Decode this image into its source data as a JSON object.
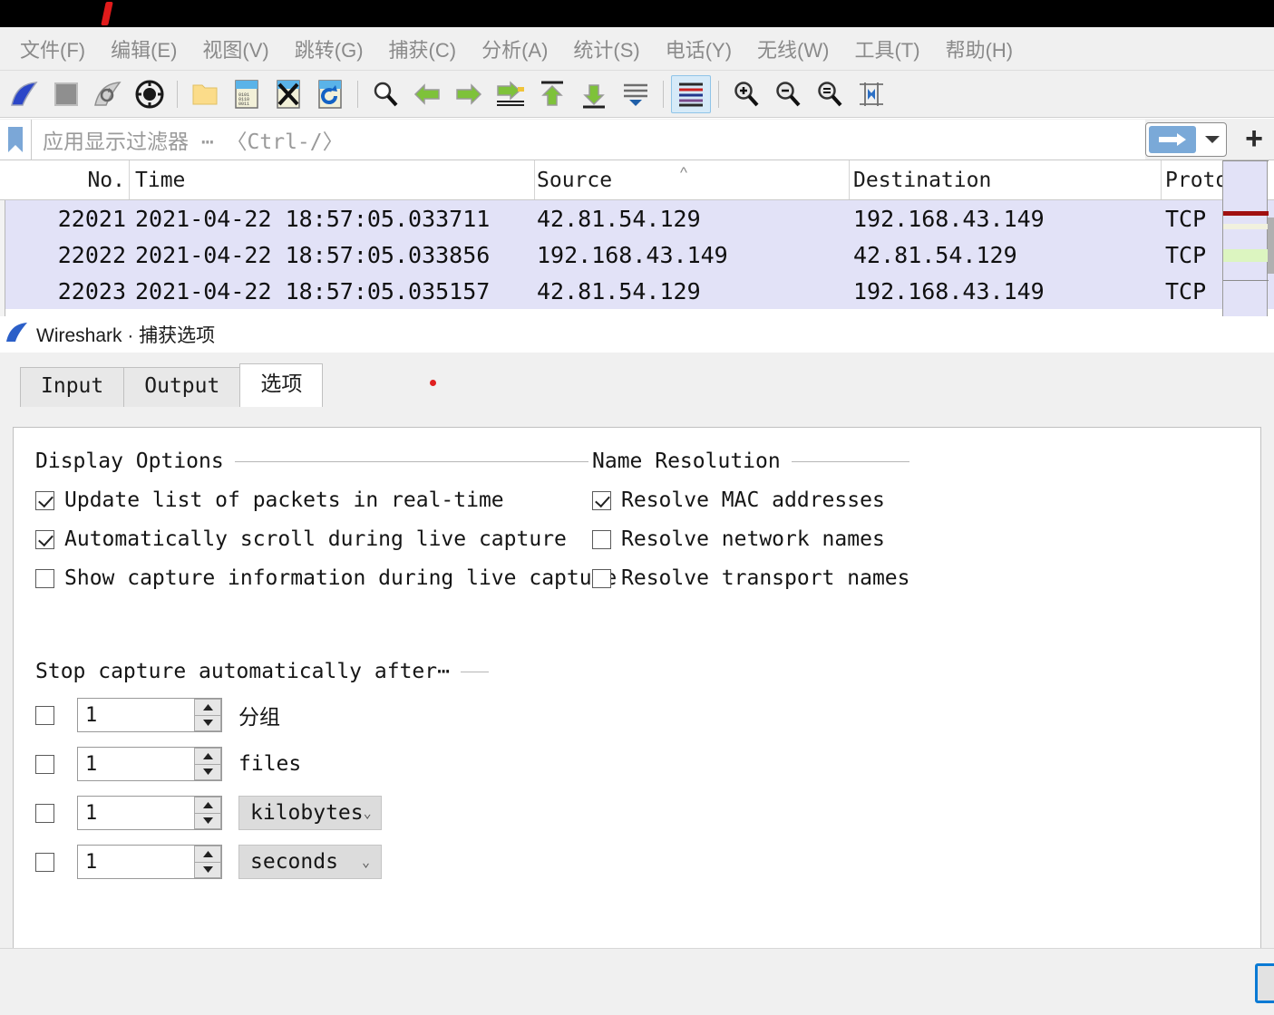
{
  "window": {
    "titlebar_annotation": "red-slash-mark"
  },
  "menubar": {
    "items": [
      {
        "label": "文件(F)",
        "name": "menu-file"
      },
      {
        "label": "编辑(E)",
        "name": "menu-edit"
      },
      {
        "label": "视图(V)",
        "name": "menu-view"
      },
      {
        "label": "跳转(G)",
        "name": "menu-go"
      },
      {
        "label": "捕获(C)",
        "name": "menu-capture"
      },
      {
        "label": "分析(A)",
        "name": "menu-analyze"
      },
      {
        "label": "统计(S)",
        "name": "menu-statistics"
      },
      {
        "label": "电话(Y)",
        "name": "menu-telephony"
      },
      {
        "label": "无线(W)",
        "name": "menu-wireless"
      },
      {
        "label": "工具(T)",
        "name": "menu-tools"
      },
      {
        "label": "帮助(H)",
        "name": "menu-help"
      }
    ]
  },
  "toolbar": {
    "icons": [
      "start-capture-icon",
      "stop-capture-icon",
      "restart-capture-icon",
      "capture-options-icon",
      "open-file-icon",
      "save-file-icon",
      "close-file-icon",
      "reload-file-icon",
      "find-packet-icon",
      "go-back-icon",
      "go-forward-icon",
      "go-to-packet-icon",
      "go-to-first-packet-icon",
      "go-to-last-packet-icon",
      "auto-scroll-icon",
      "colorize-packets-icon",
      "zoom-in-icon",
      "zoom-out-icon",
      "zoom-reset-icon",
      "resize-columns-icon"
    ]
  },
  "filter": {
    "placeholder": "应用显示过滤器 ⋯ 〈Ctrl-/〉",
    "value": "",
    "bookmark_icon": "bookmark-icon",
    "apply_icon": "arrow-right-icon",
    "dropdown_icon": "chevron-down-icon",
    "add_label": "+"
  },
  "packet_list": {
    "columns": [
      {
        "label": "No.",
        "name": "column-no"
      },
      {
        "label": "Time",
        "name": "column-time"
      },
      {
        "label": "Source",
        "name": "column-source",
        "sorted": "asc"
      },
      {
        "label": "Destination",
        "name": "column-destination"
      },
      {
        "label": "Proto",
        "name": "column-protocol"
      }
    ],
    "sort_indicator": "^",
    "rows": [
      {
        "no": "22021",
        "time": "2021-04-22 18:57:05.033711",
        "source": "42.81.54.129",
        "destination": "192.168.43.149",
        "protocol": "TCP"
      },
      {
        "no": "22022",
        "time": "2021-04-22 18:57:05.033856",
        "source": "192.168.43.149",
        "destination": "42.81.54.129",
        "protocol": "TCP"
      },
      {
        "no": "22023",
        "time": "2021-04-22 18:57:05.035157",
        "source": "42.81.54.129",
        "destination": "192.168.43.149",
        "protocol": "TCP"
      }
    ],
    "selection_color": "#e2e2f7"
  },
  "dialog": {
    "title": "Wireshark · 捕获选项",
    "icon": "wireshark-fin-icon",
    "tabs": [
      {
        "label": "Input",
        "active": false,
        "name": "tab-input"
      },
      {
        "label": "Output",
        "active": false,
        "name": "tab-output"
      },
      {
        "label": "选项",
        "active": true,
        "name": "tab-options"
      }
    ],
    "display_options": {
      "title": "Display Options",
      "items": [
        {
          "label": "Update list of packets in real-time",
          "checked": true,
          "name": "checkbox-update-list-realtime"
        },
        {
          "label": "Automatically scroll during live capture",
          "checked": true,
          "name": "checkbox-auto-scroll"
        },
        {
          "label": "Show capture information during live capture",
          "checked": false,
          "name": "checkbox-show-capture-info"
        }
      ]
    },
    "name_resolution": {
      "title": "Name Resolution",
      "items": [
        {
          "label": "Resolve MAC addresses",
          "checked": true,
          "name": "checkbox-resolve-mac"
        },
        {
          "label": "Resolve network names",
          "checked": false,
          "name": "checkbox-resolve-network"
        },
        {
          "label": "Resolve transport names",
          "checked": false,
          "name": "checkbox-resolve-transport"
        }
      ]
    },
    "stop_capture": {
      "title": "Stop capture automatically after⋯",
      "rows": [
        {
          "checked": false,
          "value": "1",
          "unit_label": "分组",
          "unit_type": "text",
          "name": "stop-after-packets"
        },
        {
          "checked": false,
          "value": "1",
          "unit_label": "files",
          "unit_type": "text",
          "name": "stop-after-files"
        },
        {
          "checked": false,
          "value": "1",
          "unit_label": "kilobytes",
          "unit_type": "select",
          "name": "stop-after-size"
        },
        {
          "checked": false,
          "value": "1",
          "unit_label": "seconds",
          "unit_type": "select",
          "name": "stop-after-duration"
        }
      ]
    }
  },
  "colors": {
    "accent_blue": "#0a7ad4",
    "selection": "#e2e2f7",
    "toolbar_bg": "#f0f0f0",
    "menu_text": "#8a8a8a",
    "annotation_red": "#e01b1b"
  }
}
